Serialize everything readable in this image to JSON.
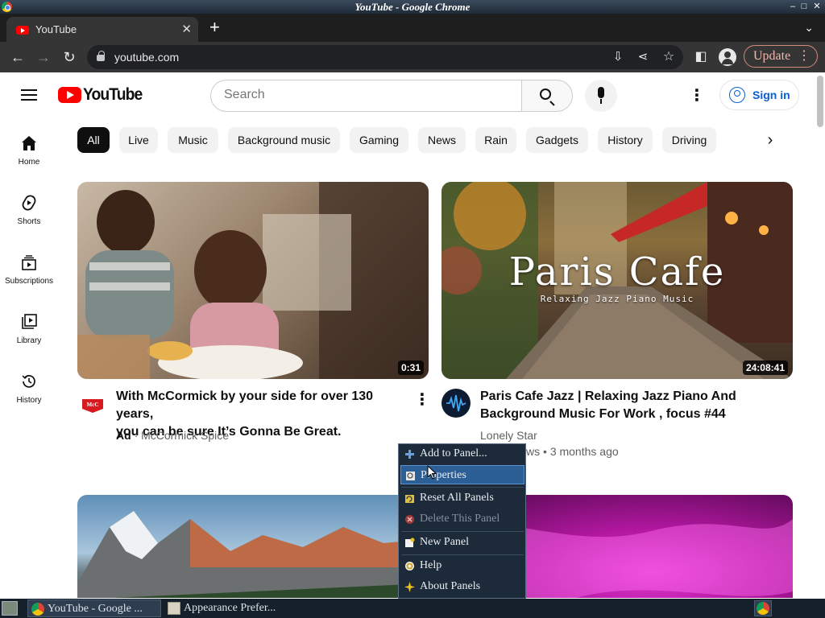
{
  "window": {
    "title": "YouTube - Google Chrome",
    "minimize": "–",
    "maximize": "□",
    "close": "✕"
  },
  "tab": {
    "title": "YouTube",
    "close": "✕",
    "new_tab": "+",
    "menu": "⌄"
  },
  "toolbar": {
    "url": "youtube.com",
    "update_label": "Update",
    "update_menu": "⋮"
  },
  "header": {
    "search_placeholder": "Search",
    "signin_label": "Sign in",
    "more": "⋮"
  },
  "chips": [
    "All",
    "Live",
    "Music",
    "Background music",
    "Gaming",
    "News",
    "Rain",
    "Gadgets",
    "History",
    "Driving"
  ],
  "chip_next": "›",
  "guide": [
    {
      "label": "Home",
      "icon": "home-icon"
    },
    {
      "label": "Shorts",
      "icon": "shorts-icon"
    },
    {
      "label": "Subscriptions",
      "icon": "subscriptions-icon"
    },
    {
      "label": "Library",
      "icon": "library-icon"
    },
    {
      "label": "History",
      "icon": "history-icon"
    }
  ],
  "videos": [
    {
      "title_line1": "With McCormick by your side for over 130 years,",
      "title_line2": "you can be sure It’s Gonna Be Great.",
      "duration": "0:31",
      "ad_badge": "Ad",
      "channel": "McCormick Spice",
      "more": "⋮"
    },
    {
      "title_line1": "Paris Cafe Jazz | Relaxing Jazz Piano And",
      "title_line2": "Background Music For Work , focus #44",
      "duration": "24:08:41",
      "thumb_title": "Paris Cafe",
      "thumb_subtitle": "Relaxing Jazz Piano Music",
      "channel": "Lonely Star",
      "meta_views_tail": "ws",
      "meta_age": "3 months ago"
    }
  ],
  "context_menu": {
    "items": [
      {
        "label": "Add to Panel...",
        "icon": "add-icon",
        "state": "normal"
      },
      {
        "label": "Properties",
        "icon": "properties-icon",
        "state": "selected"
      },
      {
        "label": "Reset All Panels",
        "icon": "reset-icon",
        "state": "normal"
      },
      {
        "label": "Delete This Panel",
        "icon": "delete-icon",
        "state": "disabled"
      },
      {
        "label": "New Panel",
        "icon": "new-panel-icon",
        "state": "normal"
      },
      {
        "label": "Help",
        "icon": "help-icon",
        "state": "normal"
      },
      {
        "label": "About Panels",
        "icon": "about-icon",
        "state": "normal"
      }
    ]
  },
  "taskbar": {
    "tasks": [
      "YouTube - Google ...",
      "Appearance Prefer..."
    ]
  },
  "colors": {
    "youtube_red": "#ff0000",
    "link_blue": "#065fd4",
    "menu_bg": "#1d2a3a",
    "menu_selected": "#2c5f96"
  }
}
